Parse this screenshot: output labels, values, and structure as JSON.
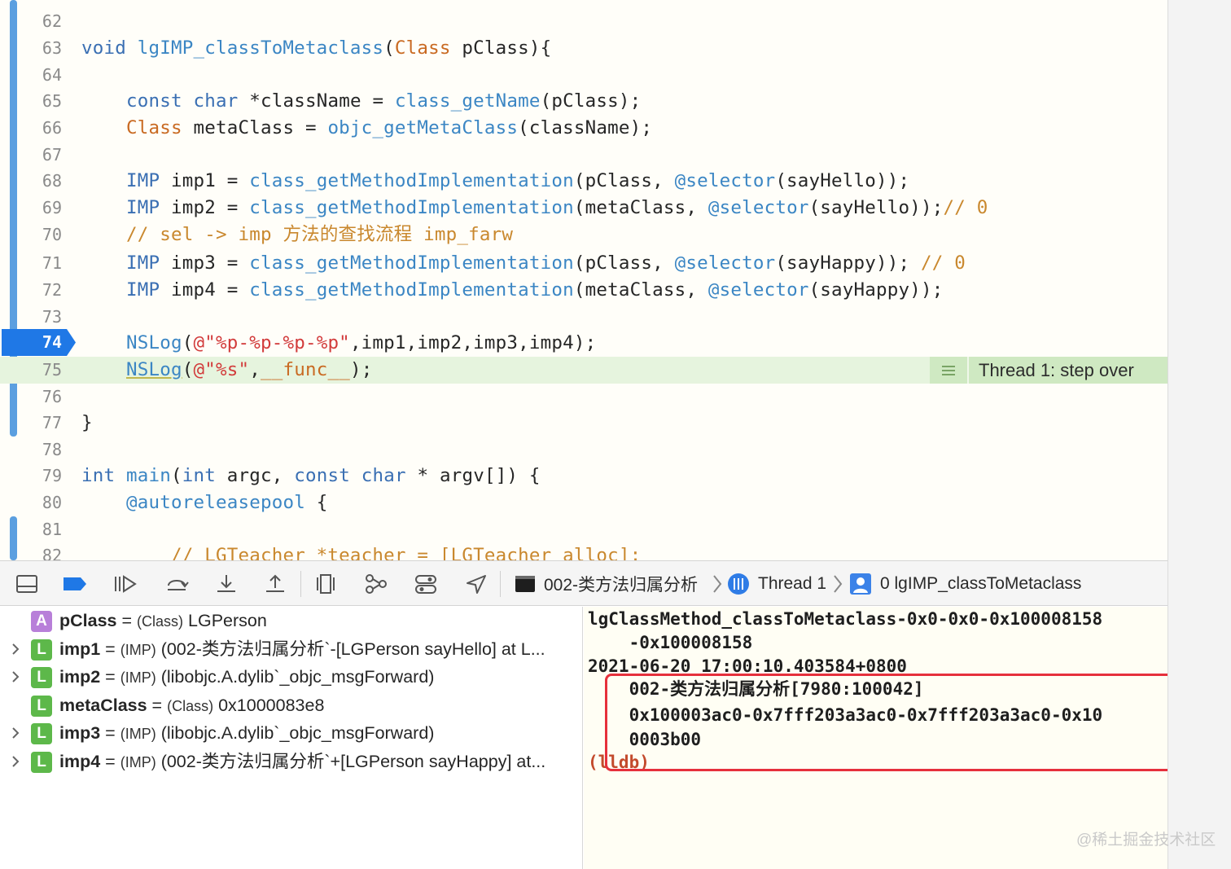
{
  "editor": {
    "lines": [
      {
        "num": "62",
        "tokens": []
      },
      {
        "num": "63",
        "tokens": [
          {
            "t": "void ",
            "c": "kw"
          },
          {
            "t": "lgIMP_classToMetaclass",
            "c": "fn"
          },
          {
            "t": "(",
            "c": ""
          },
          {
            "t": "Class",
            "c": "ty"
          },
          {
            "t": " pClass){",
            "c": ""
          }
        ]
      },
      {
        "num": "64",
        "tokens": []
      },
      {
        "num": "65",
        "tokens": [
          {
            "t": "    ",
            "c": ""
          },
          {
            "t": "const",
            "c": "kw"
          },
          {
            "t": " ",
            "c": ""
          },
          {
            "t": "char",
            "c": "kw"
          },
          {
            "t": " *className = ",
            "c": ""
          },
          {
            "t": "class_getName",
            "c": "fn"
          },
          {
            "t": "(pClass);",
            "c": ""
          }
        ]
      },
      {
        "num": "66",
        "tokens": [
          {
            "t": "    ",
            "c": ""
          },
          {
            "t": "Class",
            "c": "ty"
          },
          {
            "t": " metaClass = ",
            "c": ""
          },
          {
            "t": "objc_getMetaClass",
            "c": "fn"
          },
          {
            "t": "(className);",
            "c": ""
          }
        ]
      },
      {
        "num": "67",
        "tokens": []
      },
      {
        "num": "68",
        "tokens": [
          {
            "t": "    ",
            "c": ""
          },
          {
            "t": "IMP",
            "c": "kw"
          },
          {
            "t": " imp1 = ",
            "c": ""
          },
          {
            "t": "class_getMethodImplementation",
            "c": "fn"
          },
          {
            "t": "(pClass, ",
            "c": ""
          },
          {
            "t": "@selector",
            "c": "fn"
          },
          {
            "t": "(sayHello));",
            "c": ""
          }
        ]
      },
      {
        "num": "69",
        "tokens": [
          {
            "t": "    ",
            "c": ""
          },
          {
            "t": "IMP",
            "c": "kw"
          },
          {
            "t": " imp2 = ",
            "c": ""
          },
          {
            "t": "class_getMethodImplementation",
            "c": "fn"
          },
          {
            "t": "(metaClass, ",
            "c": ""
          },
          {
            "t": "@selector",
            "c": "fn"
          },
          {
            "t": "(sayHello));",
            "c": ""
          },
          {
            "t": "// 0",
            "c": "cm"
          }
        ]
      },
      {
        "num": "70",
        "tokens": [
          {
            "t": "    ",
            "c": ""
          },
          {
            "t": "// sel -> imp 方法的查找流程 imp_farw",
            "c": "cm"
          }
        ]
      },
      {
        "num": "71",
        "tokens": [
          {
            "t": "    ",
            "c": ""
          },
          {
            "t": "IMP",
            "c": "kw"
          },
          {
            "t": " imp3 = ",
            "c": ""
          },
          {
            "t": "class_getMethodImplementation",
            "c": "fn"
          },
          {
            "t": "(pClass, ",
            "c": ""
          },
          {
            "t": "@selector",
            "c": "fn"
          },
          {
            "t": "(sayHappy)); ",
            "c": ""
          },
          {
            "t": "// 0",
            "c": "cm"
          }
        ]
      },
      {
        "num": "72",
        "tokens": [
          {
            "t": "    ",
            "c": ""
          },
          {
            "t": "IMP",
            "c": "kw"
          },
          {
            "t": " imp4 = ",
            "c": ""
          },
          {
            "t": "class_getMethodImplementation",
            "c": "fn"
          },
          {
            "t": "(metaClass, ",
            "c": ""
          },
          {
            "t": "@selector",
            "c": "fn"
          },
          {
            "t": "(sayHappy));",
            "c": ""
          }
        ]
      },
      {
        "num": "73",
        "tokens": []
      },
      {
        "num": "74",
        "tokens": [
          {
            "t": "    ",
            "c": ""
          },
          {
            "t": "NSLog",
            "c": "fn"
          },
          {
            "t": "(",
            "c": ""
          },
          {
            "t": "@\"%p-%p-%p-%p\"",
            "c": "str"
          },
          {
            "t": ",imp1,imp2,imp3,imp4);",
            "c": ""
          }
        ]
      },
      {
        "num": "75",
        "tokens": [
          {
            "t": "    ",
            "c": ""
          },
          {
            "t": "NSLog",
            "c": "fn under"
          },
          {
            "t": "(",
            "c": ""
          },
          {
            "t": "@\"%s\"",
            "c": "str"
          },
          {
            "t": ",",
            "c": ""
          },
          {
            "t": "__func__",
            "c": "mac"
          },
          {
            "t": ");",
            "c": ""
          }
        ]
      },
      {
        "num": "76",
        "tokens": []
      },
      {
        "num": "77",
        "tokens": [
          {
            "t": "}",
            "c": ""
          }
        ]
      },
      {
        "num": "78",
        "tokens": []
      },
      {
        "num": "79",
        "tokens": [
          {
            "t": "int",
            "c": "kw"
          },
          {
            "t": " ",
            "c": ""
          },
          {
            "t": "main",
            "c": "fn"
          },
          {
            "t": "(",
            "c": ""
          },
          {
            "t": "int",
            "c": "kw"
          },
          {
            "t": " argc, ",
            "c": ""
          },
          {
            "t": "const",
            "c": "kw"
          },
          {
            "t": " ",
            "c": ""
          },
          {
            "t": "char",
            "c": "kw"
          },
          {
            "t": " * argv[]) {",
            "c": ""
          }
        ]
      },
      {
        "num": "80",
        "tokens": [
          {
            "t": "    ",
            "c": ""
          },
          {
            "t": "@autoreleasepool",
            "c": "fn"
          },
          {
            "t": " {",
            "c": ""
          }
        ]
      },
      {
        "num": "81",
        "tokens": []
      },
      {
        "num": "82",
        "tokens": [
          {
            "t": "        ",
            "c": ""
          },
          {
            "t": "// LGTeacher *teacher = [LGTeacher alloc];",
            "c": "cm"
          }
        ]
      }
    ],
    "current_line": "74",
    "thread_badge": "Thread 1: step over"
  },
  "debug_bar": {
    "crumbs": {
      "target": "002-类方法归属分析",
      "thread": "Thread 1",
      "frame": "0 lgIMP_classToMetaclass"
    }
  },
  "variables": [
    {
      "kind": "A",
      "expandable": false,
      "name": "pClass",
      "type": "(Class)",
      "value": "LGPerson"
    },
    {
      "kind": "L",
      "expandable": true,
      "name": "imp1",
      "type": "(IMP)",
      "value": "(002-类方法归属分析`-[LGPerson sayHello] at L..."
    },
    {
      "kind": "L",
      "expandable": true,
      "name": "imp2",
      "type": "(IMP)",
      "value": "(libobjc.A.dylib`_objc_msgForward)"
    },
    {
      "kind": "L",
      "expandable": false,
      "name": "metaClass",
      "type": "(Class)",
      "value": "0x1000083e8"
    },
    {
      "kind": "L",
      "expandable": true,
      "name": "imp3",
      "type": "(IMP)",
      "value": "(libobjc.A.dylib`_objc_msgForward)"
    },
    {
      "kind": "L",
      "expandable": true,
      "name": "imp4",
      "type": "(IMP)",
      "value": "(002-类方法归属分析`+[LGPerson sayHappy] at..."
    }
  ],
  "console": {
    "lines": [
      "lgClassMethod_classToMetaclass-0x0-0x0-0x100008158",
      "    -0x100008158",
      "2021-06-20 17:00:10.403584+0800",
      "    002-类方法归属分析[7980:100042]",
      "    0x100003ac0-0x7fff203a3ac0-0x7fff203a3ac0-0x10",
      "    0003b00"
    ],
    "prompt": "(lldb)"
  },
  "watermark": "@稀土掘金技术社区",
  "colors": {
    "highlight_green": "#e6f4de",
    "pc_blue": "#1f78e6",
    "annotation_red": "#e6303c"
  }
}
